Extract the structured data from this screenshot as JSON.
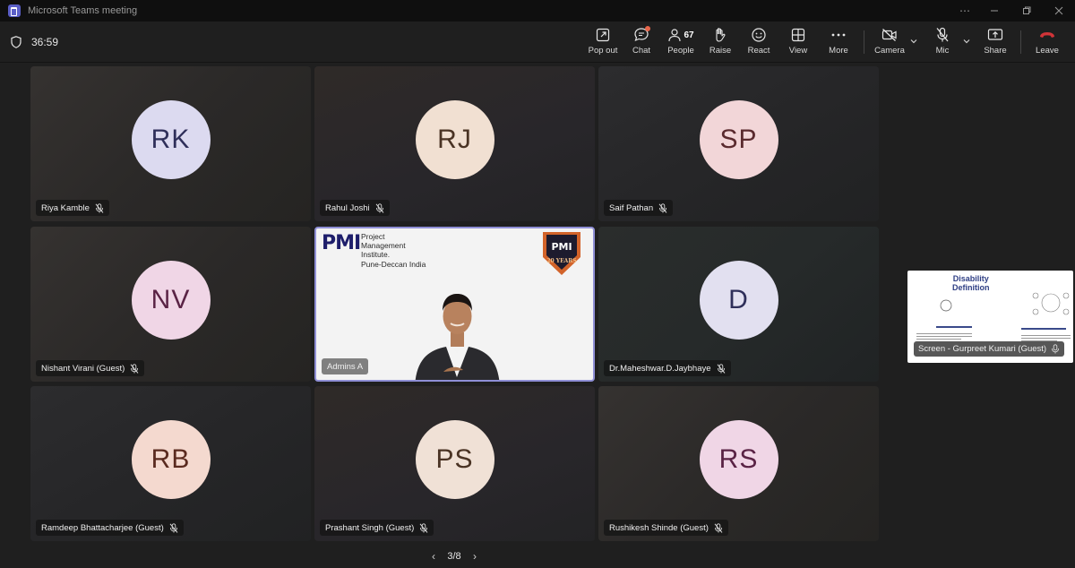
{
  "window": {
    "title": "Microsoft Teams meeting",
    "more_icon": "ellipsis-icon",
    "minimize_icon": "minimize-icon",
    "restore_icon": "restore-icon",
    "close_icon": "close-icon"
  },
  "toolbar": {
    "timer": "36:59",
    "buttons": {
      "popout": "Pop out",
      "chat": "Chat",
      "people": "People",
      "people_count": "67",
      "raise": "Raise",
      "react": "React",
      "view": "View",
      "more": "More",
      "camera": "Camera",
      "mic": "Mic",
      "share": "Share",
      "leave": "Leave"
    },
    "leave_color": "#d13438",
    "chat_badge_color": "#e8664a"
  },
  "tiles": [
    {
      "initials": "RK",
      "name": "Riya Kamble",
      "avatar_bg": "#dcdaf0",
      "avatar_fg": "#2f2f5a"
    },
    {
      "initials": "RJ",
      "name": "Rahul Joshi",
      "avatar_bg": "#f1e0d2",
      "avatar_fg": "#4a3324"
    },
    {
      "initials": "SP",
      "name": "Saif Pathan",
      "avatar_bg": "#f2d6d8",
      "avatar_fg": "#5a2a2e"
    },
    {
      "initials": "NV",
      "name": "Nishant Virani (Guest)",
      "avatar_bg": "#f0d6e6",
      "avatar_fg": "#5a2345"
    },
    {
      "initials": "",
      "name": "Admins A",
      "video": true
    },
    {
      "initials": "D",
      "name": "Dr.Maheshwar.D.Jaybhaye",
      "avatar_bg": "#e2e0f0",
      "avatar_fg": "#2f2f5a"
    },
    {
      "initials": "RB",
      "name": "Ramdeep Bhattacharjee (Guest)",
      "avatar_bg": "#f4d9cf",
      "avatar_fg": "#5a2a1f"
    },
    {
      "initials": "PS",
      "name": "Prashant Singh (Guest)",
      "avatar_bg": "#f0e1d6",
      "avatar_fg": "#4a3324"
    },
    {
      "initials": "RS",
      "name": "Rushikesh Shinde (Guest)",
      "avatar_bg": "#f0d6e6",
      "avatar_fg": "#5a2345"
    }
  ],
  "video_tile": {
    "logo_letters": "PMI",
    "org_line1": "Project",
    "org_line2": "Management",
    "org_line3": "Institute.",
    "org_line4": "Pune-Deccan India",
    "badge_text": "20 YEARS"
  },
  "screen_share": {
    "slide_title_line1": "Disability",
    "slide_title_line2": "Definition",
    "label": "Screen - Gurpreet Kumari (Guest)"
  },
  "pager": {
    "text": "3/8"
  }
}
